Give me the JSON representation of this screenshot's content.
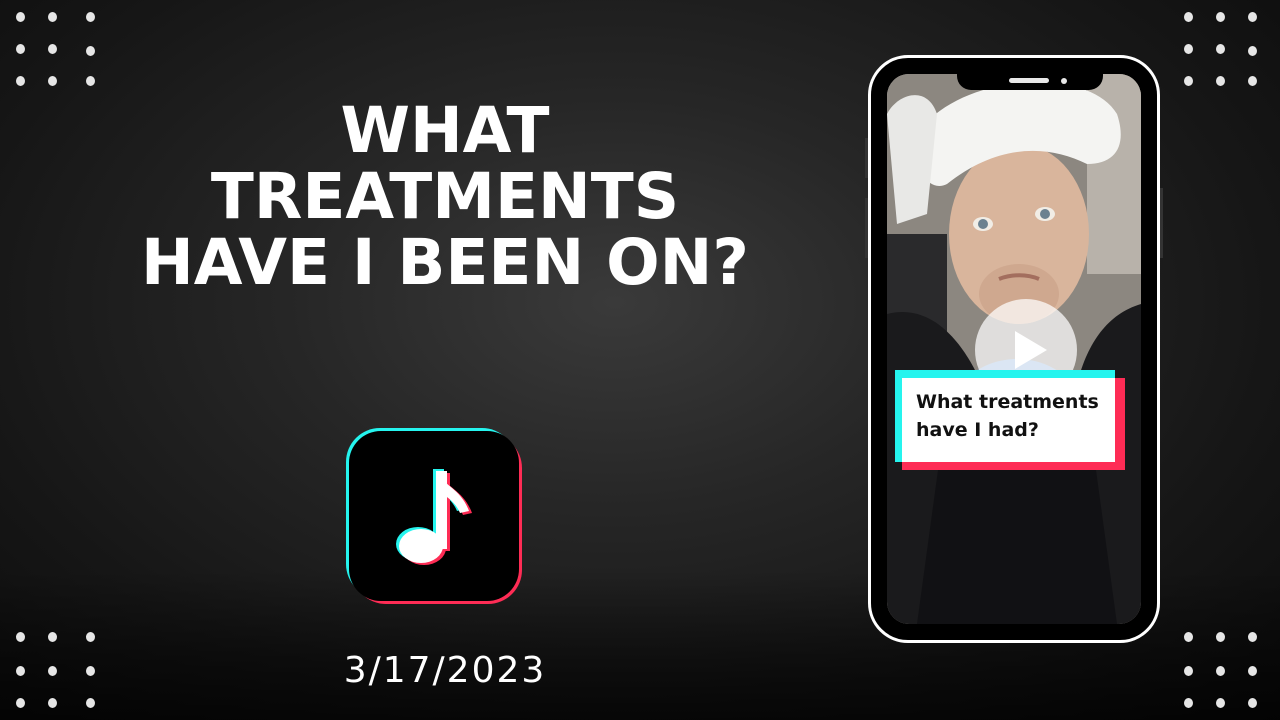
{
  "headline": {
    "line1": "WHAT",
    "line2": "TREATMENTS",
    "line3": "HAVE I BEEN ON?"
  },
  "date": "3/17/2023",
  "logo": {
    "icon": "music-note-icon",
    "colors": {
      "cyan": "#25f4ee",
      "red": "#fe2c55",
      "black": "#000000"
    }
  },
  "phone": {
    "video_caption": {
      "line1": "What treatments",
      "line2": "have I had?"
    },
    "play_icon": "play-icon"
  },
  "colors": {
    "background": "#1e1e1e",
    "text": "#ffffff"
  }
}
